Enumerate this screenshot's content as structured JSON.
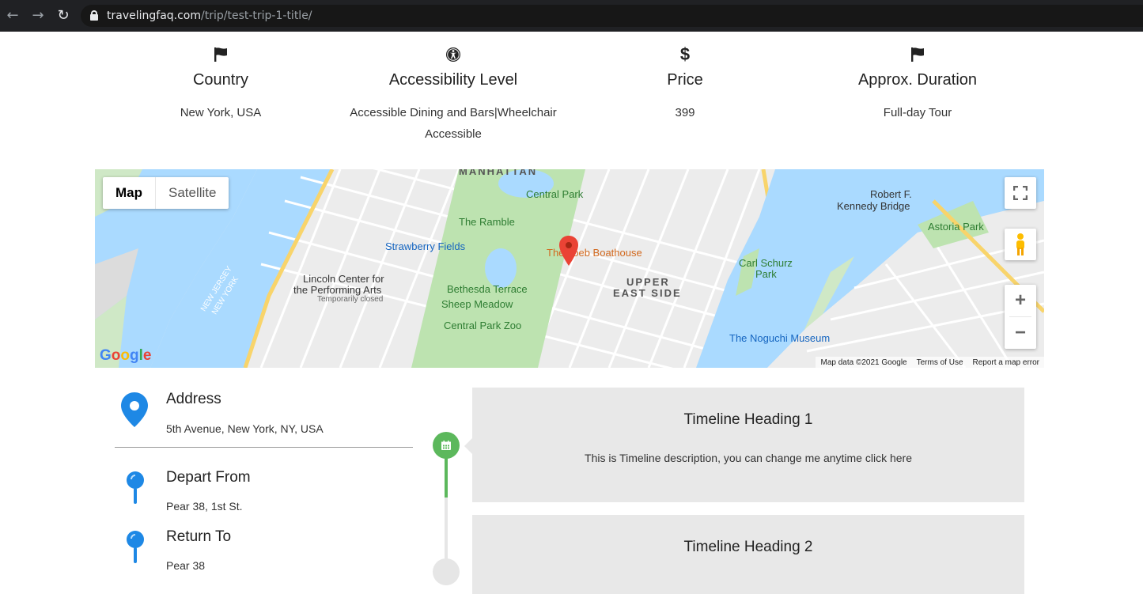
{
  "browser": {
    "domain": "travelingfaq.com",
    "path": "/trip/test-trip-1-title/"
  },
  "info": [
    {
      "icon": "flag-icon",
      "title": "Country",
      "value": "New York, USA"
    },
    {
      "icon": "universal-access-icon",
      "title": "Accessibility Level",
      "value": "Accessible Dining and Bars|Wheelchair Accessible"
    },
    {
      "icon": "dollar-icon",
      "title": "Price",
      "value": "399"
    },
    {
      "icon": "flag-icon",
      "title": "Approx. Duration",
      "value": "Full-day Tour"
    }
  ],
  "map": {
    "type_map": "Map",
    "type_satellite": "Satellite",
    "labels": {
      "manhattan": "MANHATTAN",
      "central_park": "Central Park",
      "the_ramble": "The Ramble",
      "strawberry_fields": "Strawberry Fields",
      "boathouse": "The Loeb Boathouse",
      "bethesda": "Bethesda Terrace",
      "sheep_meadow": "Sheep Meadow",
      "lincoln_1": "Lincoln Center for",
      "lincoln_2": "the Performing Arts",
      "lincoln_3": "Temporarily closed",
      "zoo": "Central Park Zoo",
      "upper": "UPPER",
      "east_side": "EAST SIDE",
      "carl_schurz_1": "Carl Schurz",
      "carl_schurz_2": "Park",
      "kennedy_1": "Robert F.",
      "kennedy_2": "Kennedy Bridge",
      "astoria_park": "Astoria Park",
      "noguchi": "The Noguchi Museum",
      "new_jersey": "NEW JERSEY",
      "new_york": "NEW YORK"
    },
    "google": "Google",
    "footer": [
      "Map data ©2021 Google",
      "Terms of Use",
      "Report a map error"
    ]
  },
  "details": {
    "address_title": "Address",
    "address_value": "5th Avenue, New York, NY, USA",
    "depart_title": "Depart From",
    "depart_value": "Pear 38, 1st St.",
    "return_title": "Return To",
    "return_value": "Pear 38"
  },
  "timeline": [
    {
      "heading": "Timeline Heading 1",
      "description": "This is Timeline description, you can change me anytime click here"
    },
    {
      "heading": "Timeline Heading 2",
      "description": ""
    }
  ],
  "colors": {
    "timeline_active": "#5cb85c",
    "pin_blue": "#1e88e5",
    "map_water": "#aadaff",
    "map_park": "#c8e6c9"
  }
}
